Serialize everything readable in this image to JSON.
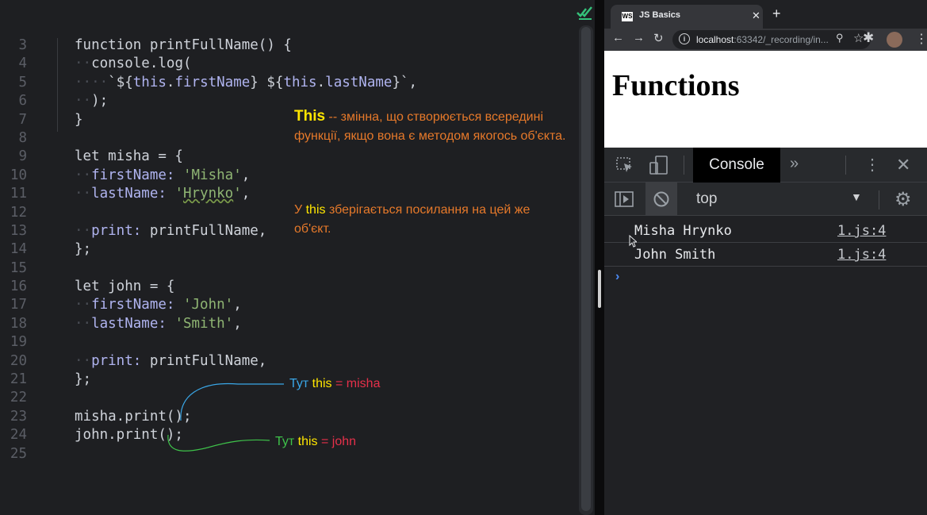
{
  "editor": {
    "lines": [
      {
        "n": "3"
      },
      {
        "n": "4"
      },
      {
        "n": "5"
      },
      {
        "n": "6"
      },
      {
        "n": "7"
      },
      {
        "n": "8"
      },
      {
        "n": "9"
      },
      {
        "n": "10"
      },
      {
        "n": "11"
      },
      {
        "n": "12"
      },
      {
        "n": "13"
      },
      {
        "n": "14"
      },
      {
        "n": "15"
      },
      {
        "n": "16"
      },
      {
        "n": "17"
      },
      {
        "n": "18"
      },
      {
        "n": "19"
      },
      {
        "n": "20"
      },
      {
        "n": "21"
      },
      {
        "n": "22"
      },
      {
        "n": "23"
      },
      {
        "n": "24"
      },
      {
        "n": "25"
      }
    ],
    "code": {
      "l3": "function printFullName() {",
      "l4a": "console",
      "l4b": ".log(",
      "l5a": "`${",
      "l5b": "this",
      "l5c": ".",
      "l5d": "firstName",
      "l5e": "} ${",
      "l5f": "this",
      "l5g": ".",
      "l5h": "lastName",
      "l5i": "}`,",
      "l6": ");",
      "l7": "}",
      "l9": "let misha = {",
      "l10a": "firstName: ",
      "l10b": "'Misha'",
      "l10c": ",",
      "l11a": "lastName: ",
      "l11b": "'",
      "l11c": "Hrynko",
      "l11d": "'",
      "l11e": ",",
      "l13a": "print: ",
      "l13b": "printFullName,",
      "l14": "};",
      "l16": "let john = {",
      "l17a": "firstName: ",
      "l17b": "'John'",
      "l17c": ",",
      "l18a": "lastName: ",
      "l18b": "'Smith'",
      "l18c": ",",
      "l20a": "print: ",
      "l20b": "printFullName,",
      "l21": "};",
      "l23": "misha.print();",
      "l24": "john.print();"
    }
  },
  "annotations": {
    "note1_this": "This",
    "note1_rest": " -- змінна, що створюється всередині функції, якщо вона є методом якогось об'єкта.",
    "note2_pre": "У ",
    "note2_this": "this",
    "note2_post": " зберігається посилання на цей же об'єкт.",
    "arrow1": {
      "tut": "Тут ",
      "this": "this",
      "eq": " = misha"
    },
    "arrow2": {
      "tut": "Тут ",
      "this": "this",
      "eq": " = john"
    },
    "colors": {
      "orange": "#e6792a",
      "yellow": "#ffe600",
      "blue": "#3aa7e8",
      "green": "#3ec24a",
      "red": "#e6304a"
    }
  },
  "browser": {
    "tab_title": "JS Basics",
    "tab_favicon": "WS",
    "url_host": "localhost",
    "url_rest": ":63342/_recording/in...",
    "page_heading": "Functions",
    "devtools": {
      "active_tab": "Console",
      "context": "top",
      "logs": [
        {
          "message": "Misha Hrynko",
          "source": "1.js:4"
        },
        {
          "message": "John Smith",
          "source": "1.js:4"
        }
      ],
      "prompt": "›"
    }
  }
}
